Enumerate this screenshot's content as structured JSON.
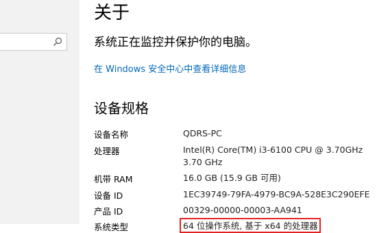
{
  "about": {
    "title": "关于",
    "subtitle": "系统正在监控并保护你的电脑。",
    "security_link": "在 Windows 安全中心中查看详细信息"
  },
  "device_specs": {
    "section_title": "设备规格",
    "rows": [
      {
        "label": "设备名称",
        "value": "QDRS-PC"
      },
      {
        "label": "处理器",
        "value": "Intel(R) Core(TM) i3-6100 CPU @ 3.70GHz   3.70 GHz"
      },
      {
        "label": "机带 RAM",
        "value": "16.0 GB (15.9 GB 可用)"
      },
      {
        "label": "设备 ID",
        "value": "1EC39749-79FA-4979-BC9A-528E3C290EFE"
      },
      {
        "label": "产品 ID",
        "value": "00329-00000-00003-AA941"
      },
      {
        "label": "系统类型",
        "value": "64 位操作系统, 基于 x64 的处理器"
      }
    ]
  }
}
